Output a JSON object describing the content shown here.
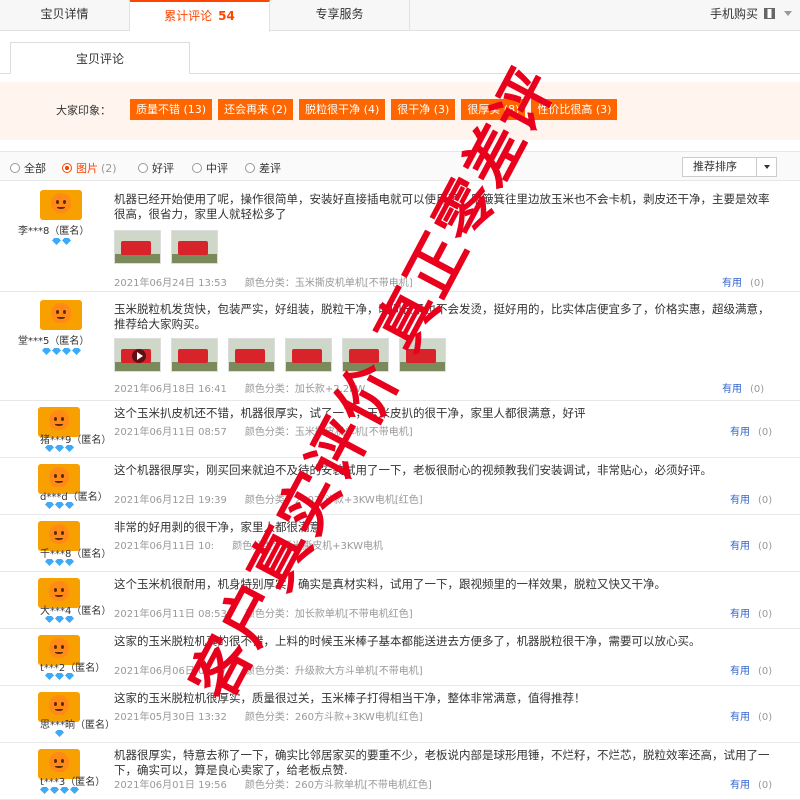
{
  "top_tabs": {
    "detail": "宝贝详情",
    "reviews": "累计评论",
    "reviews_count": "54",
    "service": "专享服务",
    "mobile": "手机购买"
  },
  "sub_tab": "宝贝评论",
  "impressions": {
    "label": "大家印象：",
    "tags": [
      "质量不错 (13)",
      "还会再来 (2)",
      "脱粒很干净 (4)",
      "很干净 (3)",
      "很厚实 (8)",
      "性价比很高 (3)"
    ]
  },
  "filters": {
    "all": "全部",
    "photo": "图片",
    "photo_count": "(2)",
    "good": "好评",
    "neutral": "中评",
    "bad": "差评",
    "sort": "推荐排序"
  },
  "useful_label": "有用",
  "reviews": [
    {
      "user": "李***8（匿名）",
      "gems": 2,
      "text": "机器已经开始使用了呢，操作很简单，安装好直接插电就可以使用了，用簸箕往里边放玉米也不会卡机，剥皮还干净，主要是效率很高，很省力，家里人就轻松多了",
      "date": "2021年06月24日 13:53",
      "spec": "颜色分类：玉米撕皮机单机[不带电机]",
      "useful_count": "(0)",
      "photos": 2
    },
    {
      "user": "堂***5（匿名）",
      "gems": 4,
      "text": "玉米脱粒机发货快，包装严实，好组装，脱粒干净，时间长了也不会发烫，挺好用的，比实体店便宜多了，价格实惠，超级满意，推荐给大家购买。",
      "date": "2021年06月18日 16:41",
      "spec": "颜色分类：加长款+2.2KW",
      "useful_count": "(0)",
      "photos": 6
    },
    {
      "user": "猪***9（匿名）",
      "gems": 3,
      "text": "这个玉米扒皮机还不错，机器很厚实，试了一下，玉米皮扒的很干净，家里人都很满意，好评",
      "date": "2021年06月11日 08:57",
      "spec": "颜色分类：玉米撕皮机单机[不带电机]",
      "useful_count": "(0)",
      "photos": 0
    },
    {
      "user": "d***d（匿名）",
      "gems": 3,
      "text": "这个机器很厚实，刚买回来就迫不及待的安装试用了一下，老板很耐心的视频教我们安装调试，非常贴心，必须好评。",
      "date": "2021年06月12日 19:39",
      "spec": "颜色分类：260方斗款+3KW电机[红色]",
      "useful_count": "(0)",
      "photos": 0
    },
    {
      "user": "千***8（匿名）",
      "gems": 3,
      "text": "非常的好用剥的很干净，家里人都很满意",
      "date": "2021年06月11日 10:",
      "spec": "颜色分类：玉米撕皮机+3KW电机",
      "useful_count": "(0)",
      "photos": 0
    },
    {
      "user": "大***4（匿名）",
      "gems": 3,
      "text": "这个玉米机很耐用，机身特别厚实，确实是真材实料，试用了一下，跟视频里的一样效果，脱粒又快又干净。",
      "date": "2021年06月11日 08:53",
      "spec": "颜色分类：加长款单机[不带电机红色]",
      "useful_count": "(0)",
      "photos": 0
    },
    {
      "user": "t***2（匿名）",
      "gems": 3,
      "text": "这家的玉米脱粒机真的很不错，上料的时候玉米棒子基本都能送进去方便多了，机器脱粒很干净，需要可以放心买。",
      "date": "2021年06月06日 09:47",
      "spec": "颜色分类：升级款大方斗单机[不带电机]",
      "useful_count": "(0)",
      "photos": 0
    },
    {
      "user": "思***晌（匿名）",
      "gems": 1,
      "text": "这家的玉米脱粒机很厚实，质量很过关，玉米棒子打得相当干净，整体非常满意，值得推荐！",
      "date": "2021年05月30日 13:32",
      "spec": "颜色分类：260方斗款+3KW电机[红色]",
      "useful_count": "(0)",
      "photos": 0
    },
    {
      "user": "t***3（匿名）",
      "gems": 4,
      "text": "机器很厚实，特意去称了一下，确实比邻居家买的要重不少，老板说内部是球形甩锤，不烂籽，不烂芯，脱粒效率还高，试用了一下，确实可以，算是良心卖家了，给老板点赞.",
      "date": "2021年06月01日 19:56",
      "spec": "颜色分类：260方斗款单机[不带电机红色]",
      "useful_count": "(0)",
      "photos": 0
    }
  ],
  "watermark": "客户真实评价 真正零差评",
  "colors": {
    "accent": "#ff4400",
    "tag_bg": "#ff6600",
    "watermark": "#e8001c",
    "link": "#3366cc"
  }
}
